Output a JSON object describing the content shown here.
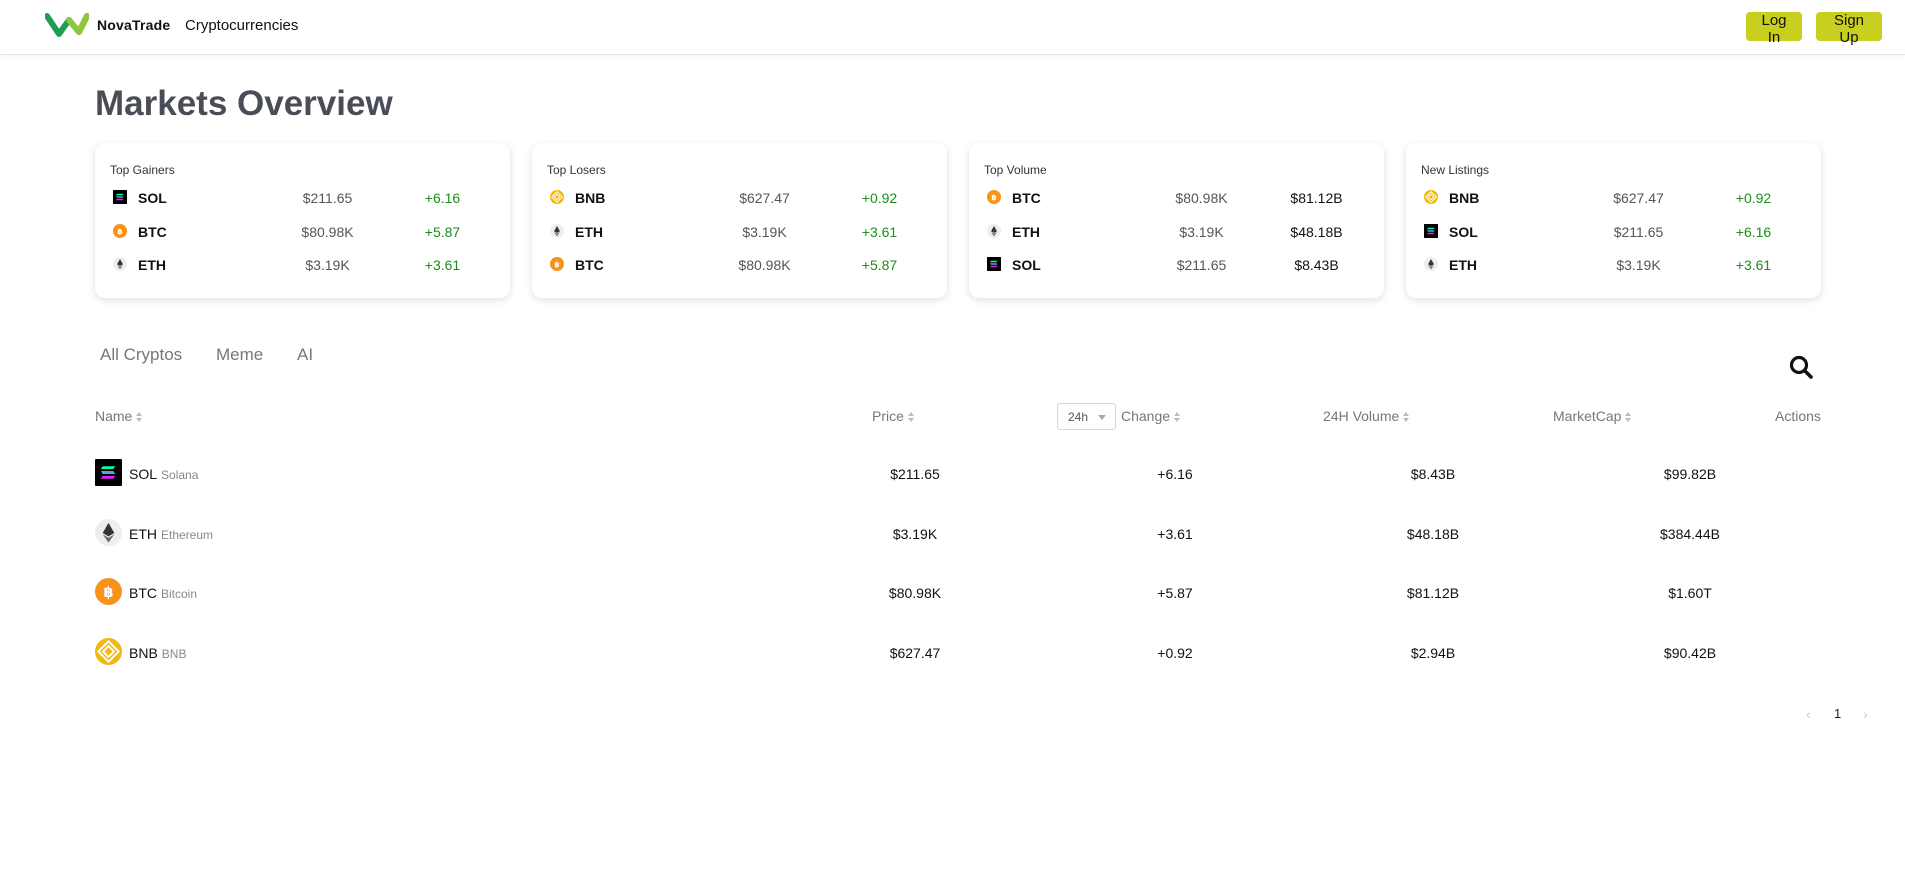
{
  "header": {
    "brand": "NovaTrade",
    "nav_link": "Cryptocurrencies",
    "login_label": "Log In",
    "signup_label": "Sign Up",
    "accent_color": "#c9cf1e"
  },
  "page": {
    "title": "Markets Overview"
  },
  "cards": [
    {
      "title": "Top Gainers",
      "rows": [
        {
          "icon": "solana-icon",
          "symbol": "SOL",
          "price": "$211.65",
          "value": "+6.16"
        },
        {
          "icon": "bitcoin-icon",
          "symbol": "BTC",
          "price": "$80.98K",
          "value": "+5.87"
        },
        {
          "icon": "ethereum-icon",
          "symbol": "ETH",
          "price": "$3.19K",
          "value": "+3.61"
        }
      ]
    },
    {
      "title": "Top Losers",
      "rows": [
        {
          "icon": "bnb-icon",
          "symbol": "BNB",
          "price": "$627.47",
          "value": "+0.92"
        },
        {
          "icon": "ethereum-icon",
          "symbol": "ETH",
          "price": "$3.19K",
          "value": "+3.61"
        },
        {
          "icon": "bitcoin-icon",
          "symbol": "BTC",
          "price": "$80.98K",
          "value": "+5.87"
        }
      ]
    },
    {
      "title": "Top Volume",
      "rows": [
        {
          "icon": "bitcoin-icon",
          "symbol": "BTC",
          "price": "$80.98K",
          "value": "$81.12B"
        },
        {
          "icon": "ethereum-icon",
          "symbol": "ETH",
          "price": "$3.19K",
          "value": "$48.18B"
        },
        {
          "icon": "solana-icon",
          "symbol": "SOL",
          "price": "$211.65",
          "value": "$8.43B"
        }
      ]
    },
    {
      "title": "New Listings",
      "rows": [
        {
          "icon": "bnb-icon",
          "symbol": "BNB",
          "price": "$627.47",
          "value": "+0.92"
        },
        {
          "icon": "solana-icon",
          "symbol": "SOL",
          "price": "$211.65",
          "value": "+6.16"
        },
        {
          "icon": "ethereum-icon",
          "symbol": "ETH",
          "price": "$3.19K",
          "value": "+3.61"
        }
      ]
    }
  ],
  "tabs": [
    "All Cryptos",
    "Meme",
    "AI"
  ],
  "table": {
    "headers": {
      "name": "Name",
      "price": "Price",
      "change": "Change",
      "volume": "24H Volume",
      "marketcap": "MarketCap",
      "actions": "Actions"
    },
    "period": "24h",
    "rows": [
      {
        "icon": "solana-icon",
        "symbol": "SOL",
        "name": "Solana",
        "price": "$211.65",
        "change": "+6.16",
        "volume": "$8.43B",
        "marketcap": "$99.82B"
      },
      {
        "icon": "ethereum-icon",
        "symbol": "ETH",
        "name": "Ethereum",
        "price": "$3.19K",
        "change": "+3.61",
        "volume": "$48.18B",
        "marketcap": "$384.44B"
      },
      {
        "icon": "bitcoin-icon",
        "symbol": "BTC",
        "name": "Bitcoin",
        "price": "$80.98K",
        "change": "+5.87",
        "volume": "$81.12B",
        "marketcap": "$1.60T"
      },
      {
        "icon": "bnb-icon",
        "symbol": "BNB",
        "name": "BNB",
        "price": "$627.47",
        "change": "+0.92",
        "volume": "$2.94B",
        "marketcap": "$90.42B"
      }
    ]
  },
  "pagination": {
    "prev": "‹",
    "current": "1",
    "next": "›"
  },
  "colors": {
    "positive": "#1a8f1a",
    "title": "#4a4d57",
    "bitcoin": "#f7931a",
    "bnb": "#f0b90b"
  }
}
